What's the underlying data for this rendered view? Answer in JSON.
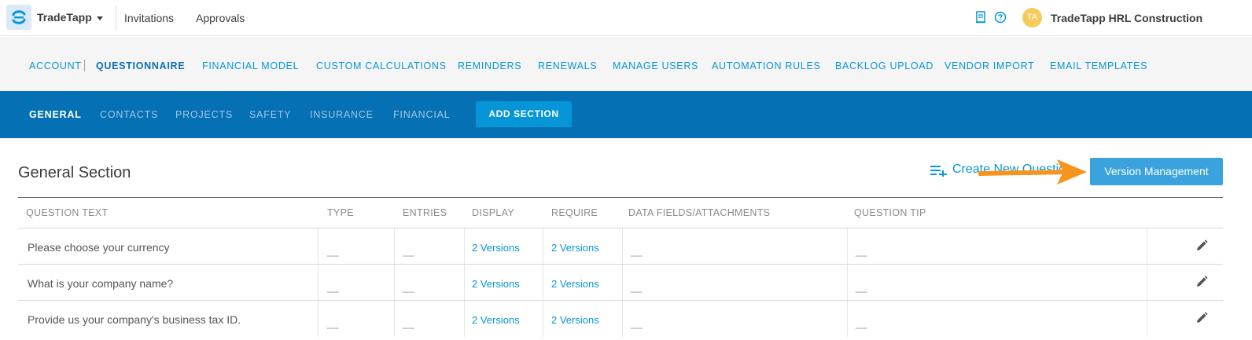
{
  "topbar": {
    "brand": "TradeTapp",
    "links": [
      "Invitations",
      "Approvals"
    ],
    "avatar_initials": "TA",
    "company": "TradeTapp HRL Construction",
    "icons": [
      "document-icon",
      "help-icon"
    ]
  },
  "settings_nav": {
    "items": [
      "ACCOUNT",
      "QUESTIONNAIRE",
      "FINANCIAL MODEL",
      "CUSTOM CALCULATIONS",
      "REMINDERS",
      "RENEWALS",
      "MANAGE USERS",
      "AUTOMATION RULES",
      "BACKLOG UPLOAD",
      "VENDOR IMPORT",
      "EMAIL TEMPLATES"
    ],
    "active": "QUESTIONNAIRE"
  },
  "section_tabs": {
    "items": [
      "GENERAL",
      "CONTACTS",
      "PROJECTS",
      "SAFETY",
      "INSURANCE",
      "FINANCIAL"
    ],
    "active": "GENERAL",
    "add_label": "ADD SECTION"
  },
  "section": {
    "title": "General Section",
    "create_label": "Create New Question",
    "version_label": "Version Management"
  },
  "table": {
    "headers": [
      "QUESTION TEXT",
      "TYPE",
      "ENTRIES",
      "DISPLAY",
      "REQUIRE",
      "DATA FIELDS/ATTACHMENTS",
      "QUESTION TIP"
    ],
    "rows": [
      {
        "question": "Please choose your currency",
        "type": "__",
        "entries": "__",
        "display": "2 Versions",
        "require": "2 Versions",
        "data_fields": "__",
        "tip": "__"
      },
      {
        "question": "What is your company name?",
        "type": "__",
        "entries": "__",
        "display": "2 Versions",
        "require": "2 Versions",
        "data_fields": "__",
        "tip": "__"
      },
      {
        "question": "Provide us your company's business tax ID.",
        "type": "__",
        "entries": "__",
        "display": "2 Versions",
        "require": "2 Versions",
        "data_fields": "__",
        "tip": "__"
      }
    ]
  },
  "colors": {
    "primary": "#0670b4",
    "accent": "#0696d7",
    "button": "#3aa3dd",
    "arrow": "#f7941d",
    "avatar": "#f5cc5c"
  }
}
